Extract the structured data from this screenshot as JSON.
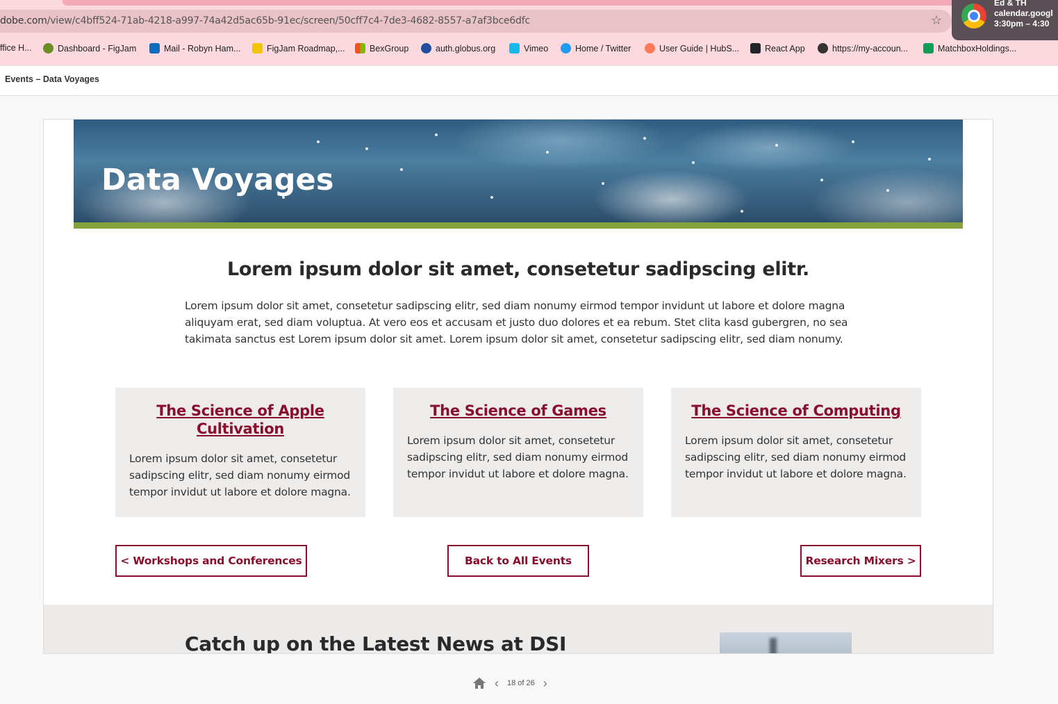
{
  "browser": {
    "url_host": "dobe.com",
    "url_path": "/view/c4bff524-71ab-4218-a997-74a42d5ac65b-91ec/screen/50cff7c4-7de3-4682-8557-a7af3bce6dfc",
    "bookmarks": [
      {
        "label": "ffice H...",
        "icon": "none",
        "color": ""
      },
      {
        "label": "Dashboard - FigJam",
        "icon": "figjam-icon",
        "color": "#6b8e23"
      },
      {
        "label": "Mail - Robyn Ham...",
        "icon": "outlook-icon",
        "color": "#0f6cbd"
      },
      {
        "label": "FigJam Roadmap,...",
        "icon": "miro-icon",
        "color": "#f5c400"
      },
      {
        "label": "BexGroup",
        "icon": "microsoft-icon",
        "color": "#f25022"
      },
      {
        "label": "auth.globus.org",
        "icon": "globus-icon",
        "color": "#1f4f9c"
      },
      {
        "label": "Vimeo",
        "icon": "vimeo-icon",
        "color": "#1ab7ea"
      },
      {
        "label": "Home / Twitter",
        "icon": "twitter-icon",
        "color": "#1d9bf0"
      },
      {
        "label": "User Guide | HubS...",
        "icon": "hubspot-icon",
        "color": "#ff7a59"
      },
      {
        "label": "React App",
        "icon": "react-icon",
        "color": "#20232a"
      },
      {
        "label": "https://my-accoun...",
        "icon": "globe-icon",
        "color": "#333333"
      },
      {
        "label": "MatchboxHoldings...",
        "icon": "sheets-icon",
        "color": "#0f9d58"
      }
    ],
    "notification": {
      "line1": "Ed & TH",
      "line2": "calendar.googl",
      "line3": "3:30pm – 4:30"
    }
  },
  "page": {
    "title": "Events – Data Voyages"
  },
  "hero": {
    "title": "Data Voyages"
  },
  "content": {
    "headline": "Lorem ipsum dolor sit amet, consetetur sadipscing elitr.",
    "intro": "Lorem ipsum dolor sit amet, consetetur sadipscing elitr, sed diam nonumy eirmod tempor invidunt ut labore et dolore magna aliquyam erat, sed diam voluptua. At vero eos et accusam et justo duo dolores et ea rebum. Stet clita kasd gubergren, no sea takimata sanctus est Lorem ipsum dolor sit amet. Lorem ipsum dolor sit amet, consetetur sadipscing elitr, sed diam nonumy.",
    "cards": [
      {
        "title": "The Science of Apple Cultivation",
        "body": "Lorem ipsum dolor sit amet, consetetur sadipscing elitr, sed diam nonumy eirmod tempor invidut ut labore et dolore magna."
      },
      {
        "title": "The Science of Games",
        "body": "Lorem ipsum dolor sit amet, consetetur sadipscing elitr, sed diam nonumy eirmod tempor invidut ut labore et dolore magna."
      },
      {
        "title": "The Science of Computing",
        "body": "Lorem ipsum dolor sit amet, consetetur sadipscing elitr, sed diam nonumy eirmod tempor invidut ut labore et dolore magna."
      }
    ],
    "nav": {
      "prev": "< Workshops and Conferences",
      "back": "Back to All Events",
      "next": "Research Mixers >"
    },
    "news_title": "Catch up on the Latest News at DSI"
  },
  "pager": {
    "count": "18 of 26"
  },
  "colors": {
    "accent": "#8a0e2e",
    "green_bar": "#84a33c",
    "card_bg": "#eeeceb"
  }
}
